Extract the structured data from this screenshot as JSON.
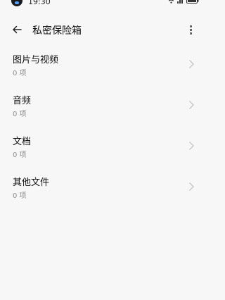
{
  "status_bar": {
    "time": "19:30"
  },
  "header": {
    "title": "私密保险箱",
    "back_icon": "back-arrow-icon",
    "more_icon": "more-vertical-icon"
  },
  "items": [
    {
      "label": "图片与视频",
      "count": "0 项"
    },
    {
      "label": "音频",
      "count": "0 项"
    },
    {
      "label": "文档",
      "count": "0 项"
    },
    {
      "label": "其他文件",
      "count": "0 项"
    }
  ],
  "colors": {
    "background": "#f7f7f7",
    "title_text": "#111111",
    "subtitle_text": "#8e8e8e",
    "chevron": "#c8c8c8"
  }
}
